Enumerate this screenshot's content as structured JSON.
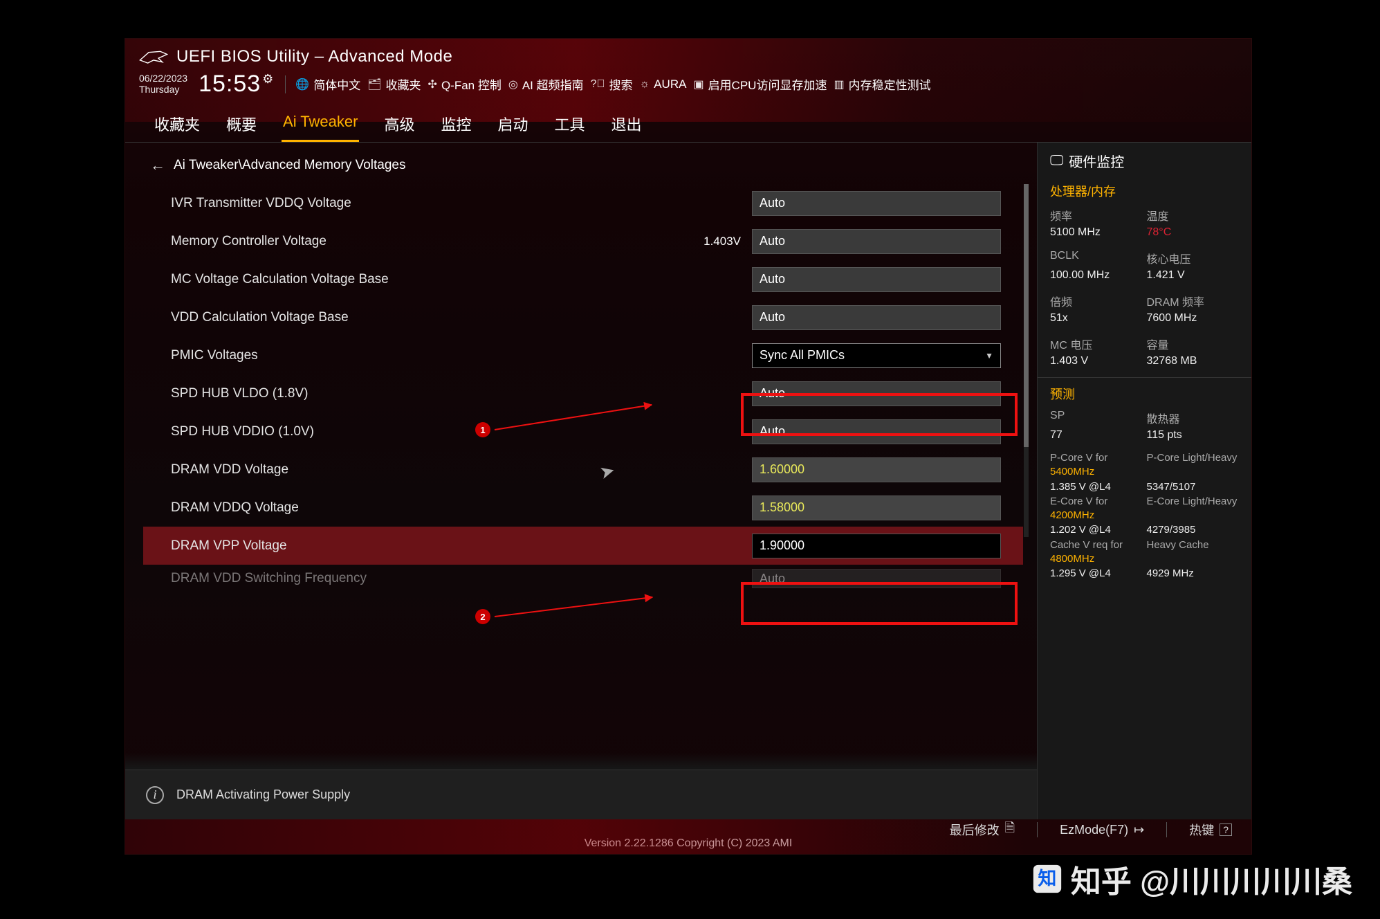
{
  "header": {
    "title": "UEFI BIOS Utility – Advanced Mode",
    "date": "06/22/2023",
    "day": "Thursday",
    "time": "15:53",
    "tools": [
      {
        "icon": "globe",
        "label": "简体中文"
      },
      {
        "icon": "folder",
        "label": "收藏夹"
      },
      {
        "icon": "fan",
        "label": "Q-Fan 控制"
      },
      {
        "icon": "ai",
        "label": "AI 超频指南"
      },
      {
        "icon": "search",
        "label": "搜索"
      },
      {
        "icon": "aura",
        "label": "AURA"
      },
      {
        "icon": "cpu",
        "label": "启用CPU访问显存加速"
      },
      {
        "icon": "mem",
        "label": "内存稳定性测试"
      }
    ]
  },
  "tabs": [
    "收藏夹",
    "概要",
    "Ai Tweaker",
    "高级",
    "监控",
    "启动",
    "工具",
    "退出"
  ],
  "active_tab": "Ai Tweaker",
  "breadcrumb": "Ai Tweaker\\Advanced Memory Voltages",
  "settings": [
    {
      "label": "IVR Transmitter VDDQ Voltage",
      "value": "Auto",
      "type": "text"
    },
    {
      "label": "Memory Controller Voltage",
      "value": "Auto",
      "aux": "1.403V",
      "type": "text"
    },
    {
      "label": "MC Voltage Calculation Voltage Base",
      "value": "Auto",
      "type": "text"
    },
    {
      "label": "VDD Calculation Voltage Base",
      "value": "Auto",
      "type": "text"
    },
    {
      "label": "PMIC Voltages",
      "value": "Sync All PMICs",
      "type": "dropdown",
      "highlight": 1
    },
    {
      "label": "SPD HUB VLDO (1.8V)",
      "value": "Auto",
      "type": "text"
    },
    {
      "label": "SPD HUB VDDIO (1.0V)",
      "value": "Auto",
      "type": "text"
    },
    {
      "label": "DRAM VDD Voltage",
      "value": "1.60000",
      "type": "text",
      "yellow": true
    },
    {
      "label": "DRAM VDDQ Voltage",
      "value": "1.58000",
      "type": "text",
      "yellow": true
    },
    {
      "label": "DRAM VPP Voltage",
      "value": "1.90000",
      "type": "text",
      "black": true,
      "selected": true,
      "highlight": 2
    },
    {
      "label": "DRAM VDD Switching Frequency",
      "value": "Auto",
      "type": "text",
      "cut": true
    }
  ],
  "help_text": "DRAM Activating Power Supply",
  "sidebar": {
    "title": "硬件监控",
    "sec1": "处理器/内存",
    "grid1": [
      {
        "k": "频率",
        "v": "5100 MHz"
      },
      {
        "k": "温度",
        "v": "78°C",
        "red": true
      },
      {
        "k": "BCLK",
        "v": "100.00 MHz"
      },
      {
        "k": "核心电压",
        "v": "1.421 V"
      },
      {
        "k": "倍频",
        "v": "51x"
      },
      {
        "k": "DRAM 频率",
        "v": "7600 MHz"
      },
      {
        "k": "MC 电压",
        "v": "1.403 V"
      },
      {
        "k": "容量",
        "v": "32768 MB"
      }
    ],
    "sec2": "预测",
    "grid2": [
      {
        "k": "SP",
        "v": "77"
      },
      {
        "k": "散热器",
        "v": "115 pts"
      }
    ],
    "pred": [
      {
        "a": "P-Core V for",
        "ay": "5400MHz",
        "b": "P-Core Light/Heavy"
      },
      {
        "a2": "1.385 V @L4",
        "b2": "5347/5107"
      },
      {
        "a": "E-Core V for",
        "ay": "4200MHz",
        "b": "E-Core Light/Heavy"
      },
      {
        "a2": "1.202 V @L4",
        "b2": "4279/3985"
      },
      {
        "a": "Cache V req for",
        "ay": "4800MHz",
        "b": "Heavy Cache"
      },
      {
        "a2": "1.295 V @L4",
        "b2": "4929 MHz"
      }
    ]
  },
  "footer": {
    "last_mod": "最后修改",
    "ezmode": "EzMode(F7)",
    "hotkey": "热键"
  },
  "version": "Version 2.22.1286 Copyright (C) 2023 AMI",
  "watermark": "知乎 @川川川川川桑"
}
